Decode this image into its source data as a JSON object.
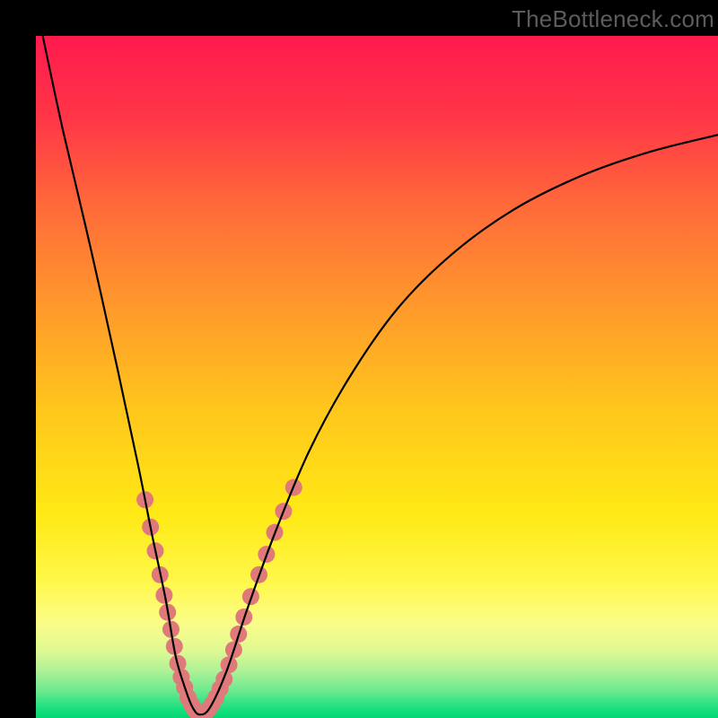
{
  "watermark": "TheBottleneck.com",
  "chart_data": {
    "type": "line",
    "title": "",
    "xlabel": "",
    "ylabel": "",
    "xlim": [
      0,
      100
    ],
    "ylim": [
      0,
      100
    ],
    "series": [
      {
        "name": "bottleneck-curve",
        "x": [
          1,
          4,
          8,
          12,
          15,
          17,
          19,
          20.5,
          22,
          23,
          24,
          25.5,
          28,
          31,
          35,
          40,
          46,
          53,
          61,
          70,
          80,
          90,
          100
        ],
        "y": [
          100,
          86,
          69,
          51,
          37,
          27,
          17.5,
          9,
          4,
          1.5,
          0.5,
          1.5,
          7,
          16,
          27,
          39,
          50,
          60,
          68,
          74.5,
          79.5,
          83,
          85.5
        ]
      }
    ],
    "markers": [
      {
        "x": 16.0,
        "y": 32.0
      },
      {
        "x": 16.8,
        "y": 28.0
      },
      {
        "x": 17.5,
        "y": 24.5
      },
      {
        "x": 18.2,
        "y": 21.0
      },
      {
        "x": 18.8,
        "y": 18.0
      },
      {
        "x": 19.3,
        "y": 15.5
      },
      {
        "x": 19.8,
        "y": 13.0
      },
      {
        "x": 20.3,
        "y": 10.5
      },
      {
        "x": 20.8,
        "y": 8.0
      },
      {
        "x": 21.3,
        "y": 6.0
      },
      {
        "x": 21.8,
        "y": 4.5
      },
      {
        "x": 22.3,
        "y": 3.0
      },
      {
        "x": 22.8,
        "y": 2.0
      },
      {
        "x": 23.3,
        "y": 1.2
      },
      {
        "x": 23.8,
        "y": 0.7
      },
      {
        "x": 24.3,
        "y": 0.6
      },
      {
        "x": 24.8,
        "y": 0.8
      },
      {
        "x": 25.3,
        "y": 1.3
      },
      {
        "x": 25.8,
        "y": 2.0
      },
      {
        "x": 26.4,
        "y": 3.0
      },
      {
        "x": 27.0,
        "y": 4.3
      },
      {
        "x": 27.6,
        "y": 5.7
      },
      {
        "x": 28.3,
        "y": 7.8
      },
      {
        "x": 29.0,
        "y": 10.0
      },
      {
        "x": 29.7,
        "y": 12.3
      },
      {
        "x": 30.5,
        "y": 14.8
      },
      {
        "x": 31.5,
        "y": 17.8
      },
      {
        "x": 32.7,
        "y": 21.0
      },
      {
        "x": 33.8,
        "y": 24.0
      },
      {
        "x": 35.0,
        "y": 27.2
      },
      {
        "x": 36.3,
        "y": 30.3
      },
      {
        "x": 37.8,
        "y": 33.8
      }
    ],
    "gradient_stops": [
      {
        "offset": 0.0,
        "color": "#ff1a4e"
      },
      {
        "offset": 0.12,
        "color": "#ff3647"
      },
      {
        "offset": 0.25,
        "color": "#ff6a3a"
      },
      {
        "offset": 0.4,
        "color": "#ff9a2b"
      },
      {
        "offset": 0.55,
        "color": "#ffc71c"
      },
      {
        "offset": 0.7,
        "color": "#ffe915"
      },
      {
        "offset": 0.8,
        "color": "#fff84a"
      },
      {
        "offset": 0.86,
        "color": "#fbfd88"
      },
      {
        "offset": 0.9,
        "color": "#e0f993"
      },
      {
        "offset": 0.93,
        "color": "#b0f296"
      },
      {
        "offset": 0.96,
        "color": "#6de98f"
      },
      {
        "offset": 0.985,
        "color": "#1de07f"
      },
      {
        "offset": 1.0,
        "color": "#00d874"
      }
    ],
    "marker_color": "#e07a7a",
    "curve_color": "#000000"
  }
}
